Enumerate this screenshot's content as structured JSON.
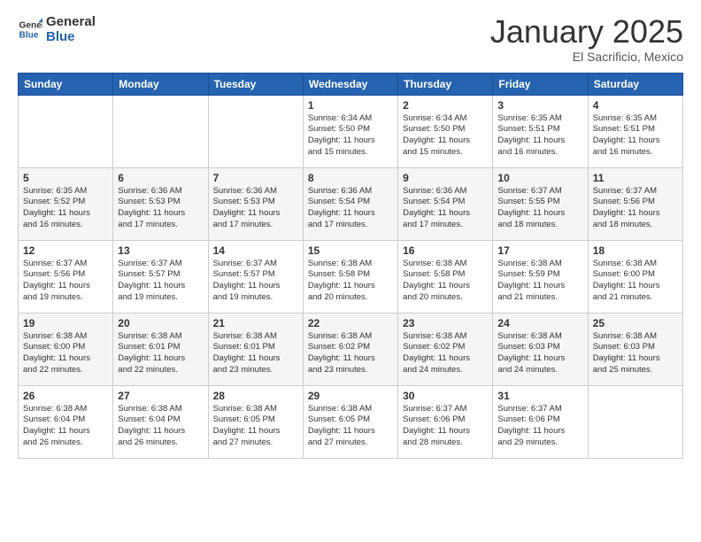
{
  "logo": {
    "line1": "General",
    "line2": "Blue"
  },
  "header": {
    "month": "January 2025",
    "location": "El Sacrificio, Mexico"
  },
  "weekdays": [
    "Sunday",
    "Monday",
    "Tuesday",
    "Wednesday",
    "Thursday",
    "Friday",
    "Saturday"
  ],
  "weeks": [
    [
      {
        "day": "",
        "info": ""
      },
      {
        "day": "",
        "info": ""
      },
      {
        "day": "",
        "info": ""
      },
      {
        "day": "1",
        "info": "Sunrise: 6:34 AM\nSunset: 5:50 PM\nDaylight: 11 hours\nand 15 minutes."
      },
      {
        "day": "2",
        "info": "Sunrise: 6:34 AM\nSunset: 5:50 PM\nDaylight: 11 hours\nand 15 minutes."
      },
      {
        "day": "3",
        "info": "Sunrise: 6:35 AM\nSunset: 5:51 PM\nDaylight: 11 hours\nand 16 minutes."
      },
      {
        "day": "4",
        "info": "Sunrise: 6:35 AM\nSunset: 5:51 PM\nDaylight: 11 hours\nand 16 minutes."
      }
    ],
    [
      {
        "day": "5",
        "info": "Sunrise: 6:35 AM\nSunset: 5:52 PM\nDaylight: 11 hours\nand 16 minutes."
      },
      {
        "day": "6",
        "info": "Sunrise: 6:36 AM\nSunset: 5:53 PM\nDaylight: 11 hours\nand 17 minutes."
      },
      {
        "day": "7",
        "info": "Sunrise: 6:36 AM\nSunset: 5:53 PM\nDaylight: 11 hours\nand 17 minutes."
      },
      {
        "day": "8",
        "info": "Sunrise: 6:36 AM\nSunset: 5:54 PM\nDaylight: 11 hours\nand 17 minutes."
      },
      {
        "day": "9",
        "info": "Sunrise: 6:36 AM\nSunset: 5:54 PM\nDaylight: 11 hours\nand 17 minutes."
      },
      {
        "day": "10",
        "info": "Sunrise: 6:37 AM\nSunset: 5:55 PM\nDaylight: 11 hours\nand 18 minutes."
      },
      {
        "day": "11",
        "info": "Sunrise: 6:37 AM\nSunset: 5:56 PM\nDaylight: 11 hours\nand 18 minutes."
      }
    ],
    [
      {
        "day": "12",
        "info": "Sunrise: 6:37 AM\nSunset: 5:56 PM\nDaylight: 11 hours\nand 19 minutes."
      },
      {
        "day": "13",
        "info": "Sunrise: 6:37 AM\nSunset: 5:57 PM\nDaylight: 11 hours\nand 19 minutes."
      },
      {
        "day": "14",
        "info": "Sunrise: 6:37 AM\nSunset: 5:57 PM\nDaylight: 11 hours\nand 19 minutes."
      },
      {
        "day": "15",
        "info": "Sunrise: 6:38 AM\nSunset: 5:58 PM\nDaylight: 11 hours\nand 20 minutes."
      },
      {
        "day": "16",
        "info": "Sunrise: 6:38 AM\nSunset: 5:58 PM\nDaylight: 11 hours\nand 20 minutes."
      },
      {
        "day": "17",
        "info": "Sunrise: 6:38 AM\nSunset: 5:59 PM\nDaylight: 11 hours\nand 21 minutes."
      },
      {
        "day": "18",
        "info": "Sunrise: 6:38 AM\nSunset: 6:00 PM\nDaylight: 11 hours\nand 21 minutes."
      }
    ],
    [
      {
        "day": "19",
        "info": "Sunrise: 6:38 AM\nSunset: 6:00 PM\nDaylight: 11 hours\nand 22 minutes."
      },
      {
        "day": "20",
        "info": "Sunrise: 6:38 AM\nSunset: 6:01 PM\nDaylight: 11 hours\nand 22 minutes."
      },
      {
        "day": "21",
        "info": "Sunrise: 6:38 AM\nSunset: 6:01 PM\nDaylight: 11 hours\nand 23 minutes."
      },
      {
        "day": "22",
        "info": "Sunrise: 6:38 AM\nSunset: 6:02 PM\nDaylight: 11 hours\nand 23 minutes."
      },
      {
        "day": "23",
        "info": "Sunrise: 6:38 AM\nSunset: 6:02 PM\nDaylight: 11 hours\nand 24 minutes."
      },
      {
        "day": "24",
        "info": "Sunrise: 6:38 AM\nSunset: 6:03 PM\nDaylight: 11 hours\nand 24 minutes."
      },
      {
        "day": "25",
        "info": "Sunrise: 6:38 AM\nSunset: 6:03 PM\nDaylight: 11 hours\nand 25 minutes."
      }
    ],
    [
      {
        "day": "26",
        "info": "Sunrise: 6:38 AM\nSunset: 6:04 PM\nDaylight: 11 hours\nand 26 minutes."
      },
      {
        "day": "27",
        "info": "Sunrise: 6:38 AM\nSunset: 6:04 PM\nDaylight: 11 hours\nand 26 minutes."
      },
      {
        "day": "28",
        "info": "Sunrise: 6:38 AM\nSunset: 6:05 PM\nDaylight: 11 hours\nand 27 minutes."
      },
      {
        "day": "29",
        "info": "Sunrise: 6:38 AM\nSunset: 6:05 PM\nDaylight: 11 hours\nand 27 minutes."
      },
      {
        "day": "30",
        "info": "Sunrise: 6:37 AM\nSunset: 6:06 PM\nDaylight: 11 hours\nand 28 minutes."
      },
      {
        "day": "31",
        "info": "Sunrise: 6:37 AM\nSunset: 6:06 PM\nDaylight: 11 hours\nand 29 minutes."
      },
      {
        "day": "",
        "info": ""
      }
    ]
  ]
}
